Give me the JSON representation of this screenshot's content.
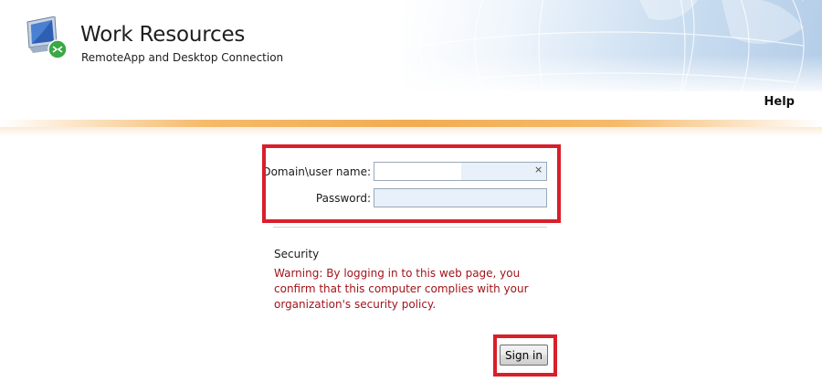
{
  "header": {
    "title": "Work Resources",
    "subtitle": "RemoteApp and Desktop Connection",
    "help_label": "Help"
  },
  "login": {
    "username_label": "Domain\\user name:",
    "password_label": "Password:",
    "username_value": "",
    "password_value": "",
    "clear_glyph": "×"
  },
  "security": {
    "heading": "Security",
    "warning": "Warning: By logging in to this web page, you confirm that this computer complies with your organization's security policy."
  },
  "actions": {
    "sign_in_label": "Sign in"
  },
  "colors": {
    "highlight": "#d81f2a",
    "warning_text": "#a2141b",
    "accent_bar": "#f0a33f"
  },
  "icons": {
    "logo": "remote-desktop-icon",
    "clear": "clear-icon"
  }
}
